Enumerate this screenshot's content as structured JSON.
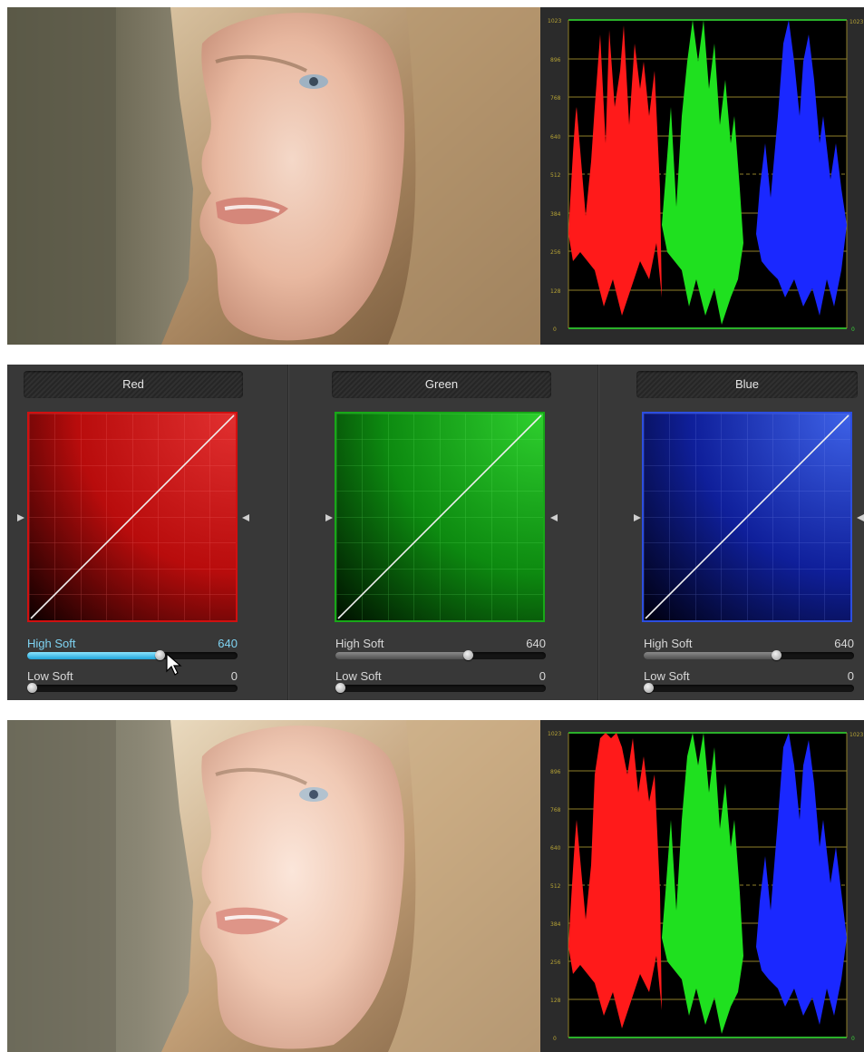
{
  "waveform": {
    "scale_labels": [
      "1023",
      "896",
      "768",
      "640",
      "512",
      "384",
      "256",
      "128",
      "0"
    ],
    "right_top_label": "1023",
    "right_bottom_label": "0"
  },
  "channels": [
    {
      "name": "Red",
      "color": "#d01010",
      "sliders": [
        {
          "label": "High Soft",
          "value": "640",
          "fraction": 0.63,
          "active": true
        },
        {
          "label": "Low Soft",
          "value": "0",
          "fraction": 0.0,
          "active": false
        }
      ]
    },
    {
      "name": "Green",
      "color": "#18a818",
      "sliders": [
        {
          "label": "High Soft",
          "value": "640",
          "fraction": 0.63,
          "active": false
        },
        {
          "label": "Low Soft",
          "value": "0",
          "fraction": 0.0,
          "active": false
        }
      ]
    },
    {
      "name": "Blue",
      "color": "#2c4ee0",
      "sliders": [
        {
          "label": "High Soft",
          "value": "640",
          "fraction": 0.63,
          "active": false
        },
        {
          "label": "Low Soft",
          "value": "0",
          "fraction": 0.0,
          "active": false
        }
      ]
    }
  ],
  "colors": {
    "active_accent": "#7fd3f2",
    "panel_bg": "#383838",
    "scope_bg": "#000000",
    "scope_grid": "#b5a235"
  }
}
